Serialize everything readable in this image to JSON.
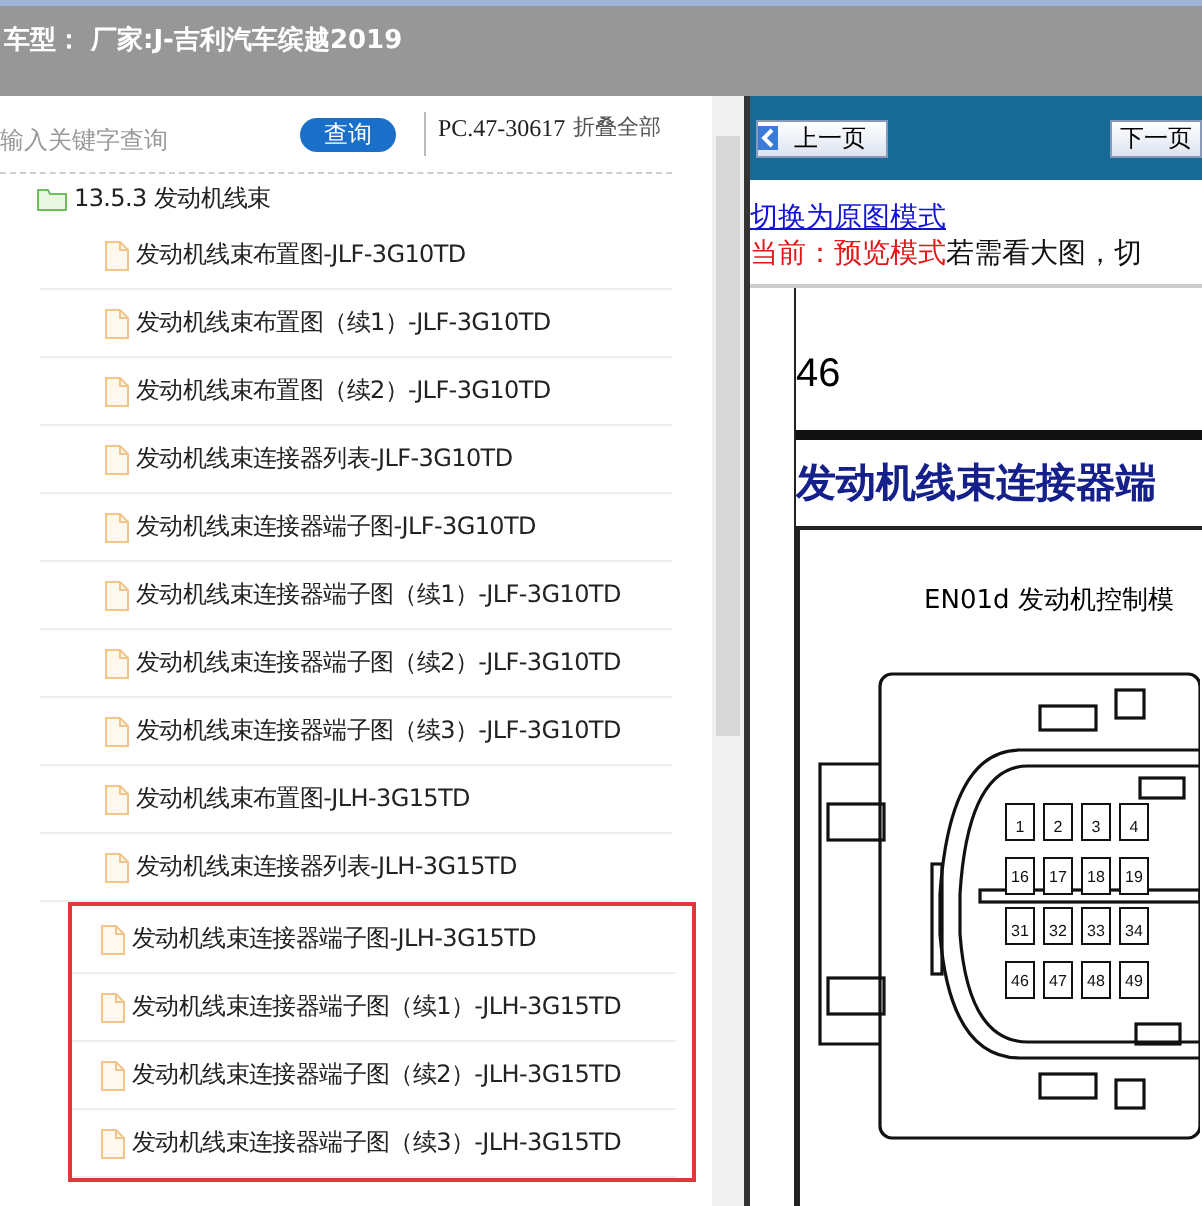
{
  "header": {
    "title": "车型： 厂家:J-吉利汽车缤越2019"
  },
  "search": {
    "placeholder": "输入关键字查询",
    "button": "查询",
    "code": "PC.47-30617",
    "collapse": "折叠全部"
  },
  "tree": [
    {
      "label": "13.5.3 发动机线束",
      "kind": "folder",
      "children": [
        {
          "label": "发动机线束布置图-JLF-3G10TD",
          "kind": "file",
          "highlighted": false
        },
        {
          "label": "发动机线束布置图（续1）-JLF-3G10TD",
          "kind": "file",
          "highlighted": false
        },
        {
          "label": "发动机线束布置图（续2）-JLF-3G10TD",
          "kind": "file",
          "highlighted": false
        },
        {
          "label": "发动机线束连接器列表-JLF-3G10TD",
          "kind": "file",
          "highlighted": false
        },
        {
          "label": "发动机线束连接器端子图-JLF-3G10TD",
          "kind": "file",
          "highlighted": false
        },
        {
          "label": "发动机线束连接器端子图（续1）-JLF-3G10TD",
          "kind": "file",
          "highlighted": false
        },
        {
          "label": "发动机线束连接器端子图（续2）-JLF-3G10TD",
          "kind": "file",
          "highlighted": false
        },
        {
          "label": "发动机线束连接器端子图（续3）-JLF-3G10TD",
          "kind": "file",
          "highlighted": false
        },
        {
          "label": "发动机线束布置图-JLH-3G15TD",
          "kind": "file",
          "highlighted": false
        },
        {
          "label": "发动机线束连接器列表-JLH-3G15TD",
          "kind": "file",
          "highlighted": false
        },
        {
          "label": "发动机线束连接器端子图-JLH-3G15TD",
          "kind": "file",
          "highlighted": true
        },
        {
          "label": "发动机线束连接器端子图（续1）-JLH-3G15TD",
          "kind": "file",
          "highlighted": true
        },
        {
          "label": "发动机线束连接器端子图（续2）-JLH-3G15TD",
          "kind": "file",
          "highlighted": true
        },
        {
          "label": "发动机线束连接器端子图（续3）-JLH-3G15TD",
          "kind": "file",
          "highlighted": true
        }
      ]
    }
  ],
  "viewer": {
    "prev": "上一页",
    "next": "下一页",
    "switch_link": "切换为原图模式",
    "mode_label": "当前：预览模式",
    "mode_hint": "若需看大图，切",
    "document": {
      "page_number": "46",
      "title": "发动机线束连接器端",
      "connector_label": "EN01d 发动机控制模",
      "pins": [
        [
          "1",
          "2",
          "3",
          "4"
        ],
        [
          "16",
          "17",
          "18",
          "19"
        ],
        [
          "31",
          "32",
          "33",
          "34"
        ],
        [
          "46",
          "47",
          "48",
          "49"
        ]
      ]
    }
  }
}
